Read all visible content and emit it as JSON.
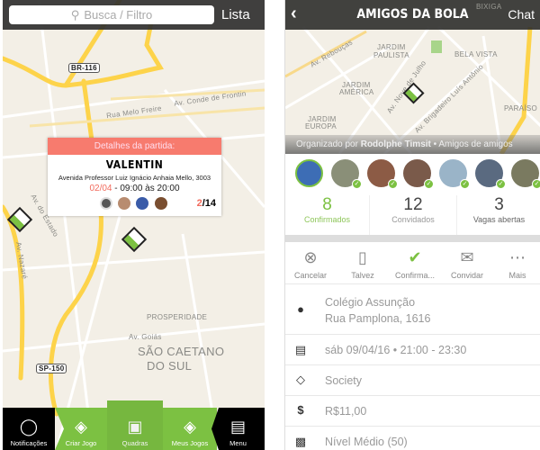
{
  "left": {
    "search_placeholder": "Busca / Filtro",
    "list_button": "Lista",
    "map_labels": [
      "BR-116",
      "Av. Conde de Frontin",
      "Rua Melo Freire",
      "Av. do Estado",
      "Av. Nazaré",
      "PROSPERIDADE",
      "Av. Goiás",
      "SÃO CAETANO",
      "DO SUL",
      "SP-150"
    ],
    "popup": {
      "header": "Detalhes da partida:",
      "title": "VALENTIN",
      "address": "Avenida Professor Luiz Ignácio Anhaia Mello, 3003",
      "date": "02/04",
      "time": " - 09:00 às 20:00",
      "count_current": "2",
      "count_total": "/14"
    },
    "nav": [
      {
        "label": "Notificações",
        "icon": "whistle-icon"
      },
      {
        "label": "Criar Jogo",
        "icon": "plus-diamond-icon"
      },
      {
        "label": "Quadras",
        "icon": "field-icon"
      },
      {
        "label": "Meus Jogos",
        "icon": "list-diamond-icon"
      },
      {
        "label": "Menu",
        "icon": "shirt-icon"
      }
    ]
  },
  "right": {
    "title": "AMIGOS DA BOLA",
    "chat": "Chat",
    "map_labels": [
      "JARDIM",
      "PAULISTA",
      "BELA VISTA",
      "JARDIM",
      "AMÉRICA",
      "JARDIM",
      "EUROPA",
      "PARAÍSO",
      "Av. Rebouças",
      "Av. Nove de Julho",
      "Av. Brigadeiro Luís Antônio",
      "BIXIGA"
    ],
    "organizer_prefix": "Organizado por ",
    "organizer": "Rodolphe Timsit",
    "group": " • Amigos de amigos",
    "stats": [
      {
        "value": "8",
        "label": "Confirmados"
      },
      {
        "value": "12",
        "label": "Convidados"
      },
      {
        "value": "3",
        "label": "Vagas abertas"
      }
    ],
    "actions": [
      {
        "label": "Cancelar",
        "icon": "cancel-icon"
      },
      {
        "label": "Talvez",
        "icon": "bookmark-icon"
      },
      {
        "label": "Confirma...",
        "icon": "check-circle-icon"
      },
      {
        "label": "Convidar",
        "icon": "envelope-icon"
      },
      {
        "label": "Mais",
        "icon": "more-icon"
      }
    ],
    "details": {
      "place": "Colégio Assunção",
      "address": "Rua Pamplona, 1616",
      "datetime": "sáb 09/04/16 • 21:00 - 23:30",
      "type": "Society",
      "price": "R$11,00",
      "level": "Nível Médio (50)"
    }
  },
  "colors": {
    "accent_green": "#7cc142",
    "popup_red": "#f77b6e",
    "header_dark": "#323230",
    "map_bg": "#f3efe6",
    "road_yellow": "#fdd34a"
  }
}
